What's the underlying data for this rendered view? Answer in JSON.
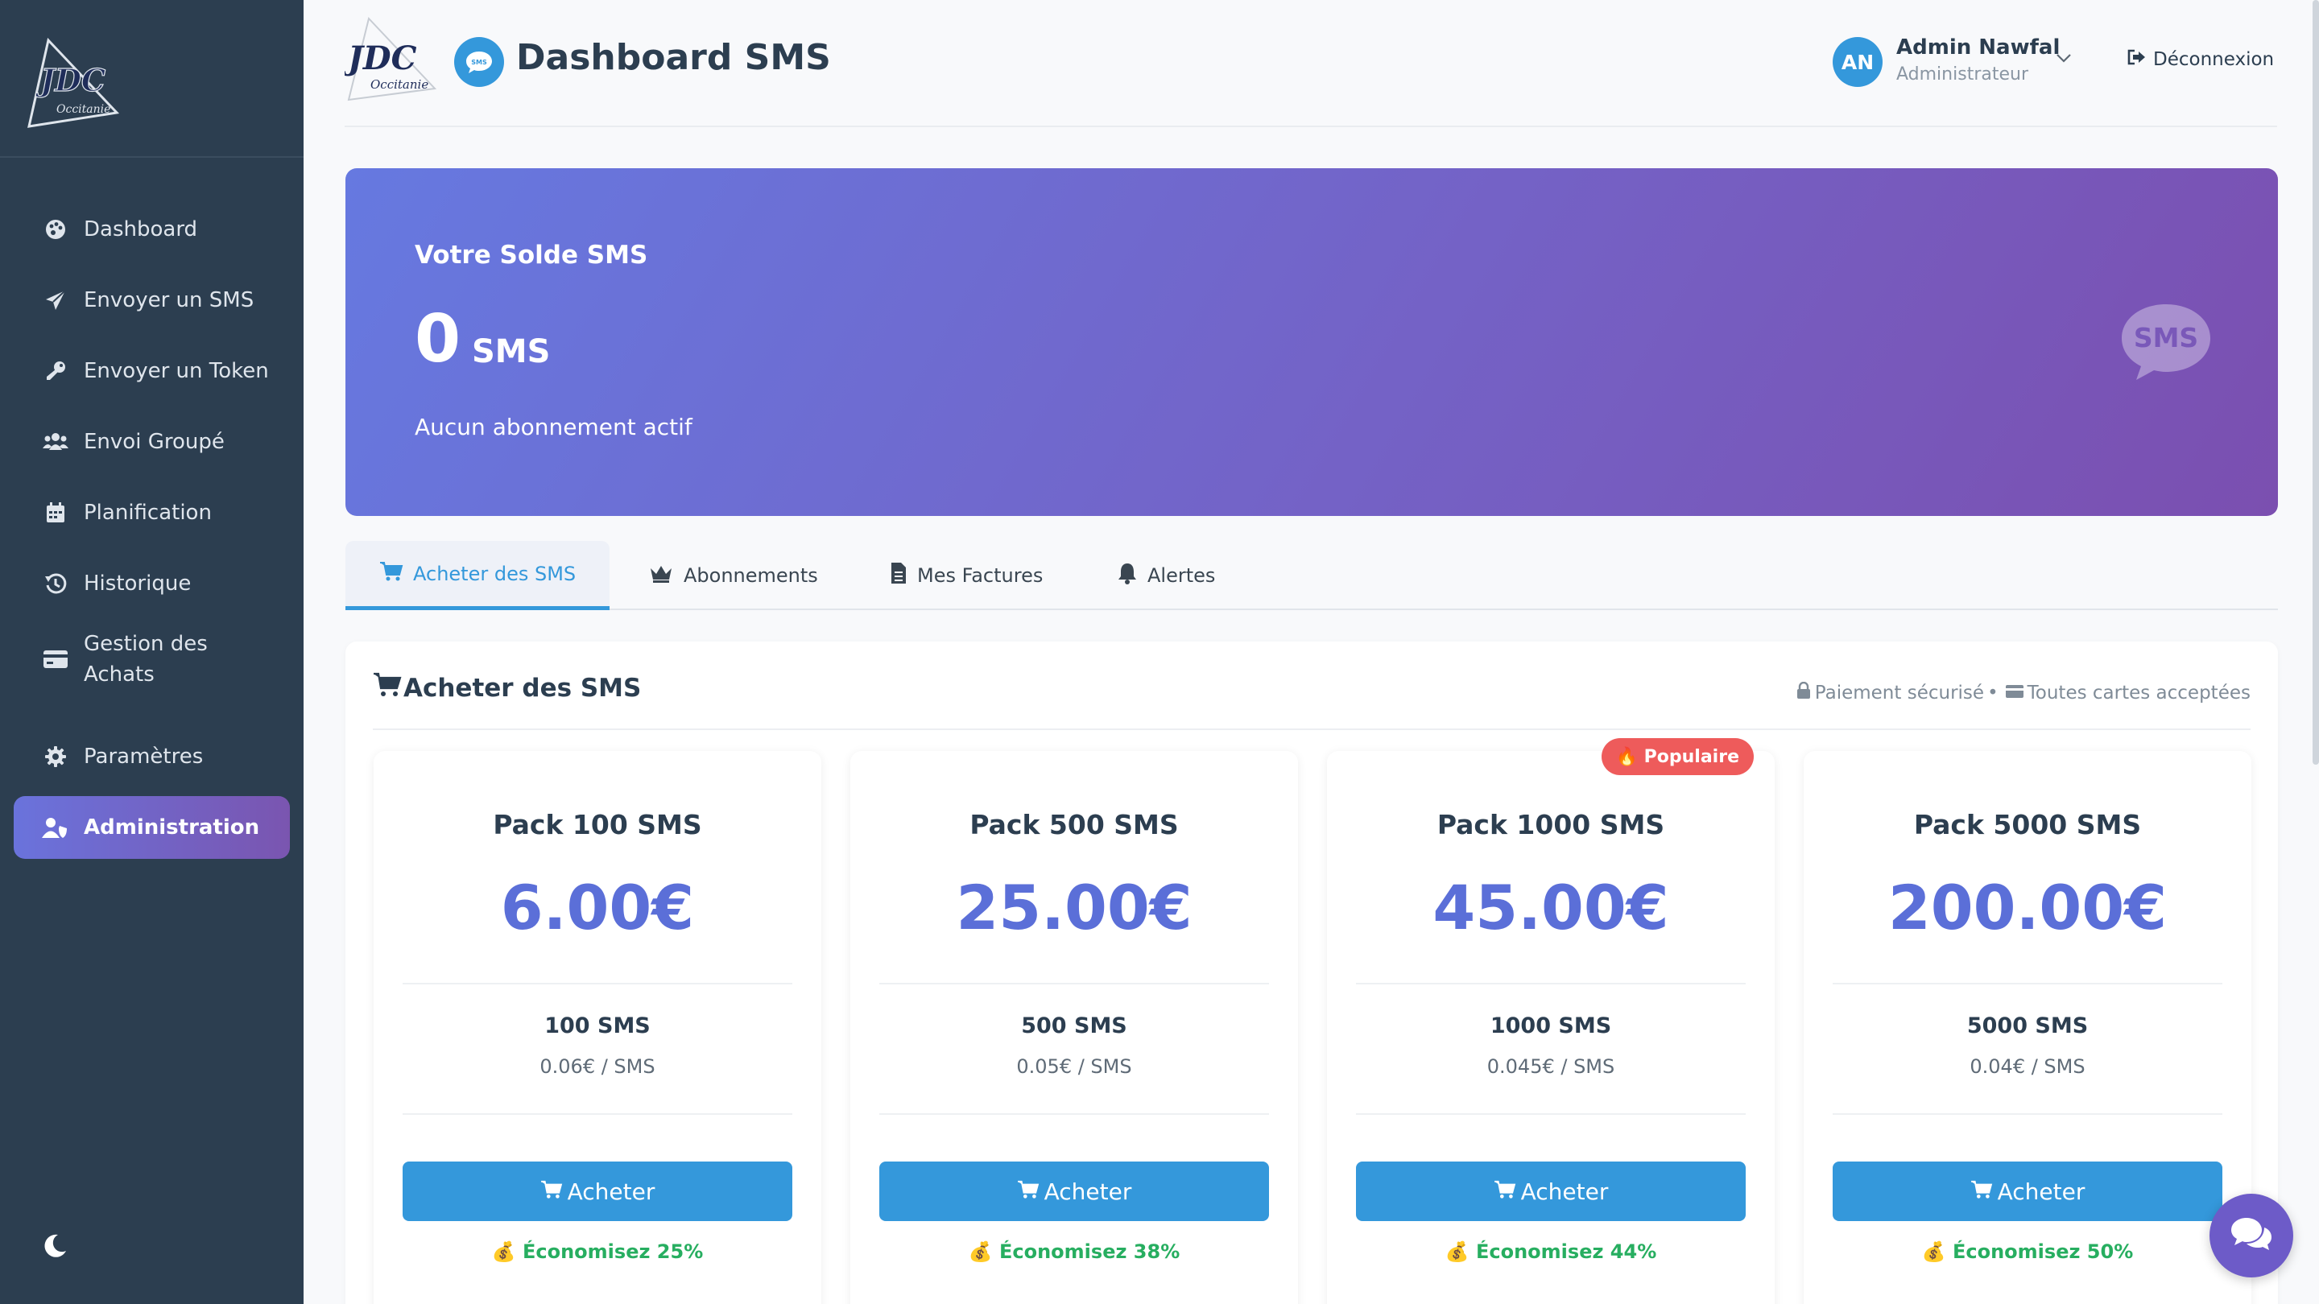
{
  "sidebar": {
    "logo": "JDC",
    "logo_sub": "Occitanie",
    "items": [
      {
        "label": "Dashboard",
        "icon": "palette-icon"
      },
      {
        "label": "Envoyer un SMS",
        "icon": "paper-plane-icon"
      },
      {
        "label": "Envoyer un Token",
        "icon": "key-icon"
      },
      {
        "label": "Envoi Groupé",
        "icon": "users-icon"
      },
      {
        "label": "Planification",
        "icon": "calendar-icon"
      },
      {
        "label": "Historique",
        "icon": "history-icon"
      },
      {
        "label": "Gestion des Achats",
        "icon": "credit-card-icon"
      },
      {
        "label": "Paramètres",
        "icon": "gear-icon"
      },
      {
        "label": "Administration",
        "icon": "user-shield-icon",
        "active": true
      }
    ]
  },
  "header": {
    "title": "Dashboard SMS",
    "user_initials": "AN",
    "user_name": "Admin Nawfal",
    "user_role": "Administrateur",
    "logout_label": "Déconnexion"
  },
  "balance": {
    "title": "Votre Solde SMS",
    "count": "0",
    "unit": "SMS",
    "subscription_status": "Aucun abonnement actif",
    "badge": "SMS"
  },
  "tabs": [
    {
      "label": "Acheter des SMS",
      "icon": "cart-icon",
      "active": true
    },
    {
      "label": "Abonnements",
      "icon": "crown-icon"
    },
    {
      "label": "Mes Factures",
      "icon": "invoice-icon"
    },
    {
      "label": "Alertes",
      "icon": "bell-icon"
    }
  ],
  "purchase": {
    "title": "Acheter des SMS",
    "secure_note": "Paiement sécurisé",
    "separator": "•",
    "cards_note": "Toutes cartes acceptées",
    "buy_label": "Acheter",
    "packs": [
      {
        "name": "Pack 100 SMS",
        "price": "6.00€",
        "qty": "100 SMS",
        "unit_price": "0.06€ / SMS",
        "savings": "💰 Économisez 25%"
      },
      {
        "name": "Pack 500 SMS",
        "price": "25.00€",
        "qty": "500 SMS",
        "unit_price": "0.05€ / SMS",
        "savings": "💰 Économisez 38%"
      },
      {
        "name": "Pack 1000 SMS",
        "price": "45.00€",
        "qty": "1000 SMS",
        "unit_price": "0.045€ / SMS",
        "savings": "💰 Économisez 44%",
        "badge": "🔥 Populaire"
      },
      {
        "name": "Pack 5000 SMS",
        "price": "200.00€",
        "qty": "5000 SMS",
        "unit_price": "0.04€ / SMS",
        "savings": "💰 Économisez 50%"
      }
    ]
  },
  "colors": {
    "sidebar_bg": "#2c3e50",
    "accent": "#3498db",
    "price": "#5b6fd8",
    "savings": "#27ae60",
    "popular": "#ee5b5b"
  }
}
